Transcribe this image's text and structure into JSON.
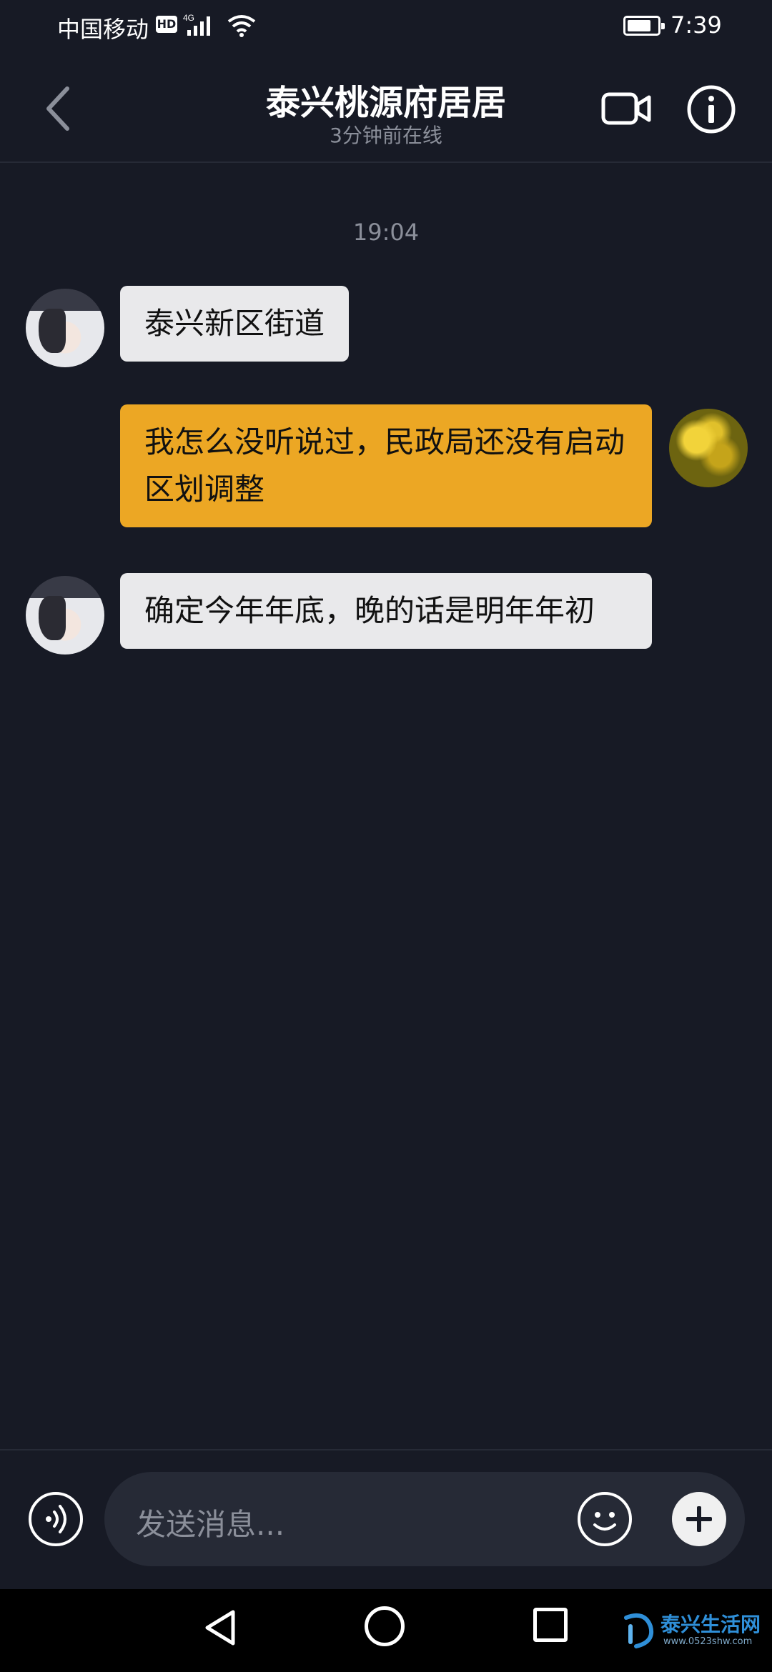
{
  "status_bar": {
    "carrier": "中国移动",
    "hd": "HD",
    "network": "4G",
    "time": "7:39"
  },
  "header": {
    "title": "泰兴桃源府居居",
    "subtitle": "3分钟前在线",
    "icons": [
      "back-icon",
      "video-call-icon",
      "info-icon"
    ]
  },
  "messages": {
    "timestamp": "19:04",
    "items": [
      {
        "direction": "incoming",
        "text": "泰兴新区街道"
      },
      {
        "direction": "outgoing",
        "text": "我怎么没听说过，民政局还没有启动区划调整"
      },
      {
        "direction": "incoming",
        "text": "确定今年年底，晚的话是明年年初"
      }
    ]
  },
  "input_bar": {
    "placeholder": "发送消息...",
    "icons": [
      "voice-icon",
      "emoji-icon",
      "plus-icon"
    ]
  },
  "nav_bar": {
    "icons": [
      "back-triangle-icon",
      "home-circle-icon",
      "recent-square-icon"
    ]
  },
  "watermark": {
    "name": "泰兴生活网",
    "url": "www.0523shw.com"
  },
  "colors": {
    "background": "#171a25",
    "incoming_bubble": "#e9e9eb",
    "outgoing_bubble": "#eca724"
  }
}
